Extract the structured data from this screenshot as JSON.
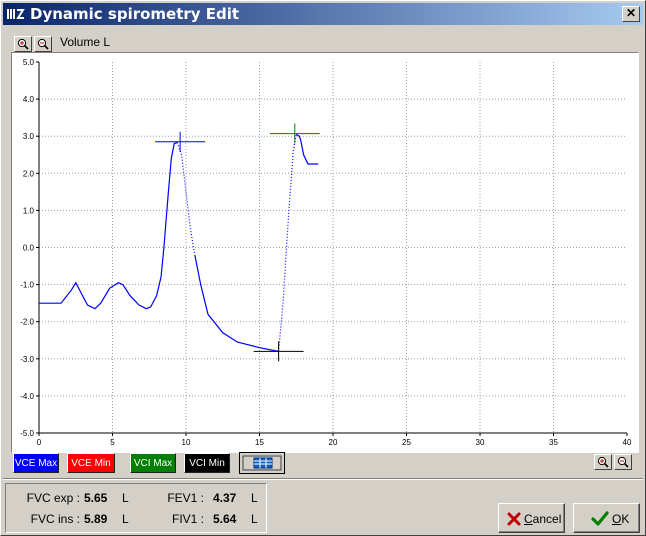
{
  "window": {
    "title": "Dynamic spirometry Edit",
    "close_label": "✕"
  },
  "chart_header": {
    "ylabel": "Volume L"
  },
  "chart_data": {
    "type": "line",
    "title": "",
    "xlabel": "",
    "ylabel": "Volume L",
    "xlim": [
      0,
      40
    ],
    "ylim": [
      -5,
      5
    ],
    "grid": true,
    "x_ticks": [
      "0",
      "5",
      "10",
      "15",
      "20",
      "25",
      "30",
      "35",
      "40"
    ],
    "y_ticks": [
      "5.0",
      "4.0",
      "3.0",
      "2.0",
      "1.0",
      "0.0",
      "-1.0",
      "-2.0",
      "-3.0",
      "-4.0",
      "-5.0"
    ],
    "series": [
      {
        "color": "#0000ff",
        "style": "solid",
        "x": [
          0,
          1.5,
          2.2,
          2.5,
          2.9,
          3.3,
          3.8,
          4.2,
          4.8,
          5.4,
          5.7,
          6.2,
          6.8,
          7.3,
          7.6,
          8.0,
          8.3,
          8.5,
          8.8,
          9.0,
          9.2,
          9.4
        ],
        "y": [
          -1.5,
          -1.5,
          -1.15,
          -0.95,
          -1.25,
          -1.55,
          -1.65,
          -1.5,
          -1.1,
          -0.95,
          -1.0,
          -1.3,
          -1.55,
          -1.65,
          -1.6,
          -1.3,
          -0.8,
          0.0,
          1.5,
          2.4,
          2.8,
          2.83
        ]
      },
      {
        "color": "#0000ff",
        "style": "dotted",
        "x": [
          9.4,
          9.7,
          10.0,
          10.3,
          10.6
        ],
        "y": [
          2.83,
          2.5,
          1.5,
          0.5,
          -0.2
        ]
      },
      {
        "color": "#0000ff",
        "style": "solid",
        "x": [
          10.6,
          11.0,
          11.5,
          12.5,
          13.5,
          15.0,
          16.3
        ],
        "y": [
          -0.2,
          -1.0,
          -1.8,
          -2.3,
          -2.55,
          -2.7,
          -2.8
        ]
      },
      {
        "color": "#0000ff",
        "style": "dotted",
        "x": [
          16.3,
          16.6,
          17.0,
          17.3,
          17.5
        ],
        "y": [
          -2.8,
          -1.5,
          1.0,
          2.6,
          3.05
        ]
      },
      {
        "color": "#0000ff",
        "style": "solid",
        "x": [
          17.5,
          17.7,
          17.8,
          18.0,
          18.3,
          19.0
        ],
        "y": [
          3.05,
          3.0,
          2.9,
          2.5,
          2.25,
          2.25
        ]
      }
    ],
    "markers": [
      {
        "name": "VCE Max",
        "color": "#0000ff",
        "x": 9.6,
        "y": 2.85,
        "half_width": 1.7
      },
      {
        "name": "VCE Min",
        "color": "#000000",
        "x": 16.3,
        "y": -2.8,
        "half_width": 1.7
      },
      {
        "name": "VCI Max",
        "color": "#008000",
        "x": 17.4,
        "y": 3.07,
        "half_width": 1.7
      }
    ]
  },
  "legend_buttons": [
    {
      "label": "VCE Max",
      "color": "#0000ff",
      "text_color": "#ffffff"
    },
    {
      "label": "VCE Min",
      "color": "#ff0000",
      "text_color": "#ffffff"
    },
    {
      "label": "VCI Max",
      "color": "#008000",
      "text_color": "#ffffff"
    },
    {
      "label": "VCI Min",
      "color": "#000000",
      "text_color": "#ffffff"
    }
  ],
  "icons": {
    "zoom_in": "zoom-in-icon",
    "zoom_out": "zoom-out-icon",
    "table": "table-icon",
    "app": "app-logo-icon",
    "cancel": "red-x-icon",
    "ok": "green-check-icon"
  },
  "stats": {
    "fvc_exp_label": "FVC exp :",
    "fvc_exp_value": "5.65",
    "fvc_exp_unit": "L",
    "fvc_ins_label": "FVC ins :",
    "fvc_ins_value": "5.89",
    "fvc_ins_unit": "L",
    "fev1_label": "FEV1 :",
    "fev1_value": "4.37",
    "fev1_unit": "L",
    "fiv1_label": "FIV1 :",
    "fiv1_value": "5.64",
    "fiv1_unit": "L"
  },
  "buttons": {
    "cancel_first": "C",
    "cancel_rest": "ancel",
    "ok_first": "O",
    "ok_rest": "K"
  }
}
